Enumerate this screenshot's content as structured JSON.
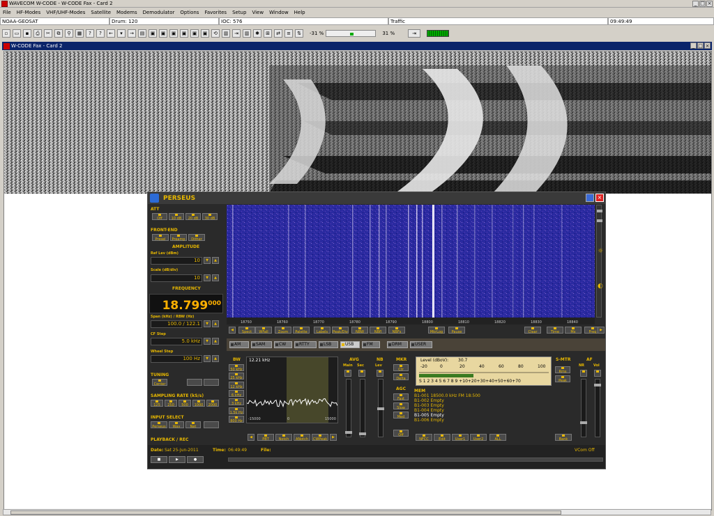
{
  "app": {
    "title": "WAVECOM W-CODE - W-CODE Fax - Card 2"
  },
  "menu": [
    "File",
    "HF-Modes",
    "VHF/UHF-Modes",
    "Satellite",
    "Modems",
    "Demodulator",
    "Options",
    "Favorites",
    "Setup",
    "View",
    "Window",
    "Help"
  ],
  "status": {
    "station": "NOAA-GEOSAT",
    "drum": "Drum: 120",
    "ioc": "IOC: 576",
    "traffic": "Traffic",
    "time": "09:49:49"
  },
  "toolbar": {
    "left_pct": "-31 %",
    "right_pct": "31 %"
  },
  "child": {
    "title": "W-CODE Fax - Card 2"
  },
  "perseus": {
    "title": "PERSEUS",
    "att": {
      "label": "ATT",
      "buttons": [
        "Off",
        "10 dB",
        "20 dB",
        "30 dB"
      ]
    },
    "frontend": {
      "label": "FRONT-END",
      "buttons": [
        "Presel",
        "Preamp",
        "Dither"
      ]
    },
    "amplitude": {
      "label": "AMPLITUDE",
      "reflev_label": "Ref Lev (dBm)",
      "reflev": "10",
      "scale_label": "Scale (dB/div)",
      "scale": "10"
    },
    "frequency": {
      "label": "FREQUENCY",
      "main": "18.799",
      "sub": "000"
    },
    "span": {
      "label": "Span (kHz) / RBW (Hz)",
      "value": "100.0 / 122.1"
    },
    "cfstep": {
      "label": "CF Step",
      "value": "5.0 kHz"
    },
    "wheel": {
      "label": "Wheel Step",
      "value": "100 Hz"
    },
    "tuning": {
      "label": "TUNING",
      "button": "Center"
    },
    "sampling": {
      "label": "SAMPLING RATE (kS/s)",
      "buttons": [
        "125",
        "250",
        "500",
        "1000",
        "2000"
      ]
    },
    "input": {
      "label": "INPUT SELECT",
      "buttons": [
        "Perseus",
        "Wav",
        "Net"
      ]
    },
    "playback": {
      "label": "PLAYBACK / REC"
    },
    "date": {
      "label": "Date:",
      "value": "Sat 25-Jun-2011"
    },
    "timefld": {
      "label": "Time:",
      "value": "06:49:49"
    },
    "file": {
      "label": "File:"
    },
    "vcom": "VCom Off",
    "axis_ticks": [
      "18750",
      "18760",
      "18770",
      "18780",
      "18790",
      "18800",
      "18810",
      "18820",
      "18830",
      "18840"
    ],
    "wfbuttons": [
      "Spect",
      "WFall",
      "Zoom",
      "Palette",
      "Labels",
      "Peak/Div",
      "NBW",
      "NBfl",
      "NBFs",
      "MkrLog",
      "Pause",
      "Clear",
      "Time",
      "Mx",
      "Freq"
    ],
    "modes": [
      "AM",
      "SAM",
      "CW",
      "RTTY",
      "LSB",
      "USB",
      "FM",
      "DRM",
      "USER"
    ],
    "bw": {
      "label": "BW",
      "buttons": [
        "50 kHz",
        "25 kHz",
        "12 kHz",
        "6 kHz",
        "3 kHz",
        "1.5k Hz",
        "800 Hz"
      ],
      "value": "12.21 kHz",
      "ticks": [
        "-15000",
        "0",
        "15000"
      ]
    },
    "filterbtns": [
      "PBT",
      "Notch",
      "ANotch",
      "CWPeak"
    ],
    "avg": {
      "label": "AVG",
      "main": "Main",
      "sec": "Sec"
    },
    "nb": {
      "label": "NB",
      "lev": "Lev"
    },
    "mkr": {
      "label": "MKR",
      "buttons": [
        "Ctr",
        "Delta"
      ]
    },
    "agc": {
      "label": "AGC",
      "buttons": [
        "Fast",
        "Slow",
        "Med",
        "Off"
      ]
    },
    "smeter": {
      "label": "Level (dBoV):",
      "value": "30.7",
      "top": [
        "-20",
        "0",
        "20",
        "40",
        "60",
        "80",
        "100"
      ],
      "bottom": "S 1 2 3 4 5 6 7 8 9 +10+20+30+40+50+60+70"
    },
    "smtr": {
      "label": "S-MTR",
      "buttons": [
        "Rms",
        "Peak"
      ]
    },
    "af": {
      "label": "AF",
      "nr": "NR",
      "vol": "Vol"
    },
    "mem": {
      "label": "MEM",
      "items": [
        "B1-001 18500.0 kHz  FM  18:500",
        "B1-002 Empty",
        "B1-003 Empty",
        "B1-004 Empty",
        "B1-005 Empty",
        "B1-006 Empty"
      ],
      "buttons": [
        "NFCC",
        "Edit",
        "User1",
        "User2",
        "ALL",
        "Bank"
      ]
    }
  }
}
